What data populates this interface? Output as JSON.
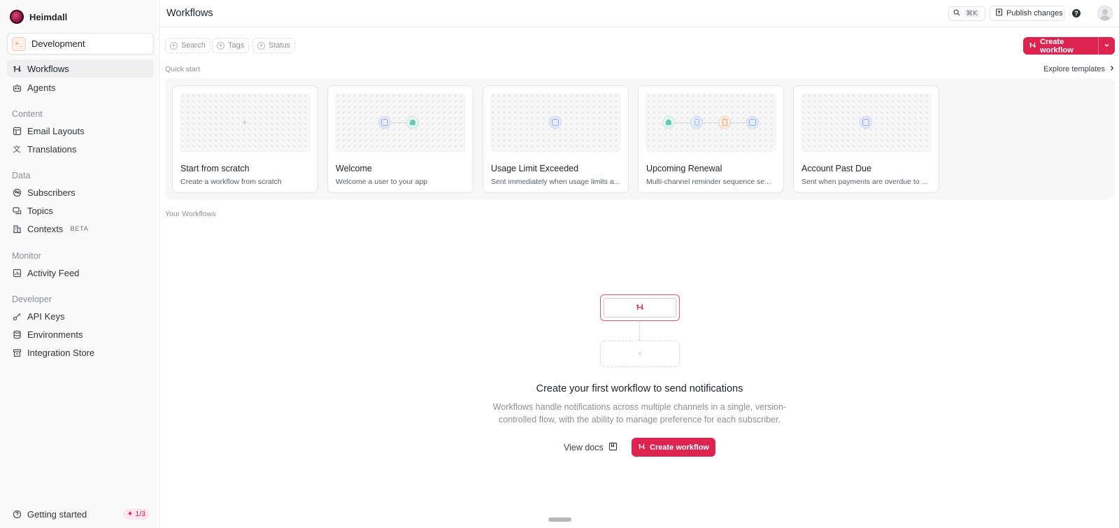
{
  "org": {
    "name": "Heimdall"
  },
  "environment": {
    "label": "Development",
    "icon": "terminal-icon"
  },
  "sidebar": {
    "primary": [
      {
        "label": "Workflows",
        "icon": "workflow-icon",
        "active": true
      },
      {
        "label": "Agents",
        "icon": "robot-icon"
      }
    ],
    "sections": [
      {
        "title": "Content",
        "items": [
          {
            "label": "Email Layouts",
            "icon": "layout-icon"
          },
          {
            "label": "Translations",
            "icon": "translate-icon"
          }
        ]
      },
      {
        "title": "Data",
        "items": [
          {
            "label": "Subscribers",
            "icon": "users-icon"
          },
          {
            "label": "Topics",
            "icon": "topics-icon"
          },
          {
            "label": "Contexts",
            "icon": "building-icon",
            "badge": "BETA"
          }
        ]
      },
      {
        "title": "Monitor",
        "items": [
          {
            "label": "Activity Feed",
            "icon": "activity-icon"
          }
        ]
      },
      {
        "title": "Developer",
        "items": [
          {
            "label": "API Keys",
            "icon": "key-icon"
          },
          {
            "label": "Environments",
            "icon": "database-icon"
          },
          {
            "label": "Integration Store",
            "icon": "store-icon"
          }
        ]
      }
    ],
    "getting_started": {
      "label": "Getting started",
      "progress": "1/3"
    }
  },
  "header": {
    "title": "Workflows",
    "search_shortcut": "⌘K",
    "publish_label": "Publish changes"
  },
  "filters": {
    "search": "Search",
    "tags": "Tags",
    "status": "Status"
  },
  "actions": {
    "create_workflow": "Create workflow"
  },
  "quick_start": {
    "label": "Quick start",
    "explore": "Explore templates",
    "templates": [
      {
        "title": "Start from scratch",
        "desc": "Create a workflow from scratch"
      },
      {
        "title": "Welcome",
        "desc": "Welcome a user to your app"
      },
      {
        "title": "Usage Limit Exceeded",
        "desc": "Sent immediately when usage limits a..."
      },
      {
        "title": "Upcoming Renewal",
        "desc": "Multi-channel reminder sequence se..."
      },
      {
        "title": "Account Past Due",
        "desc": "Sent when payments are overdue to ..."
      }
    ]
  },
  "your_workflows": {
    "label": "Your Workflows",
    "empty_title": "Create your first workflow to send notifications",
    "empty_desc": "Workflows handle notifications across multiple channels in a single, version-controlled flow, with the ability to manage preference for each subscriber.",
    "view_docs": "View docs",
    "create_label": "Create workflow"
  },
  "colors": {
    "accent": "#dd2451",
    "email_node": "#8fa3e8",
    "inapp_node": "#6ac7b3",
    "push_node": "#9fb4ee",
    "delay_node": "#f0a77b"
  }
}
